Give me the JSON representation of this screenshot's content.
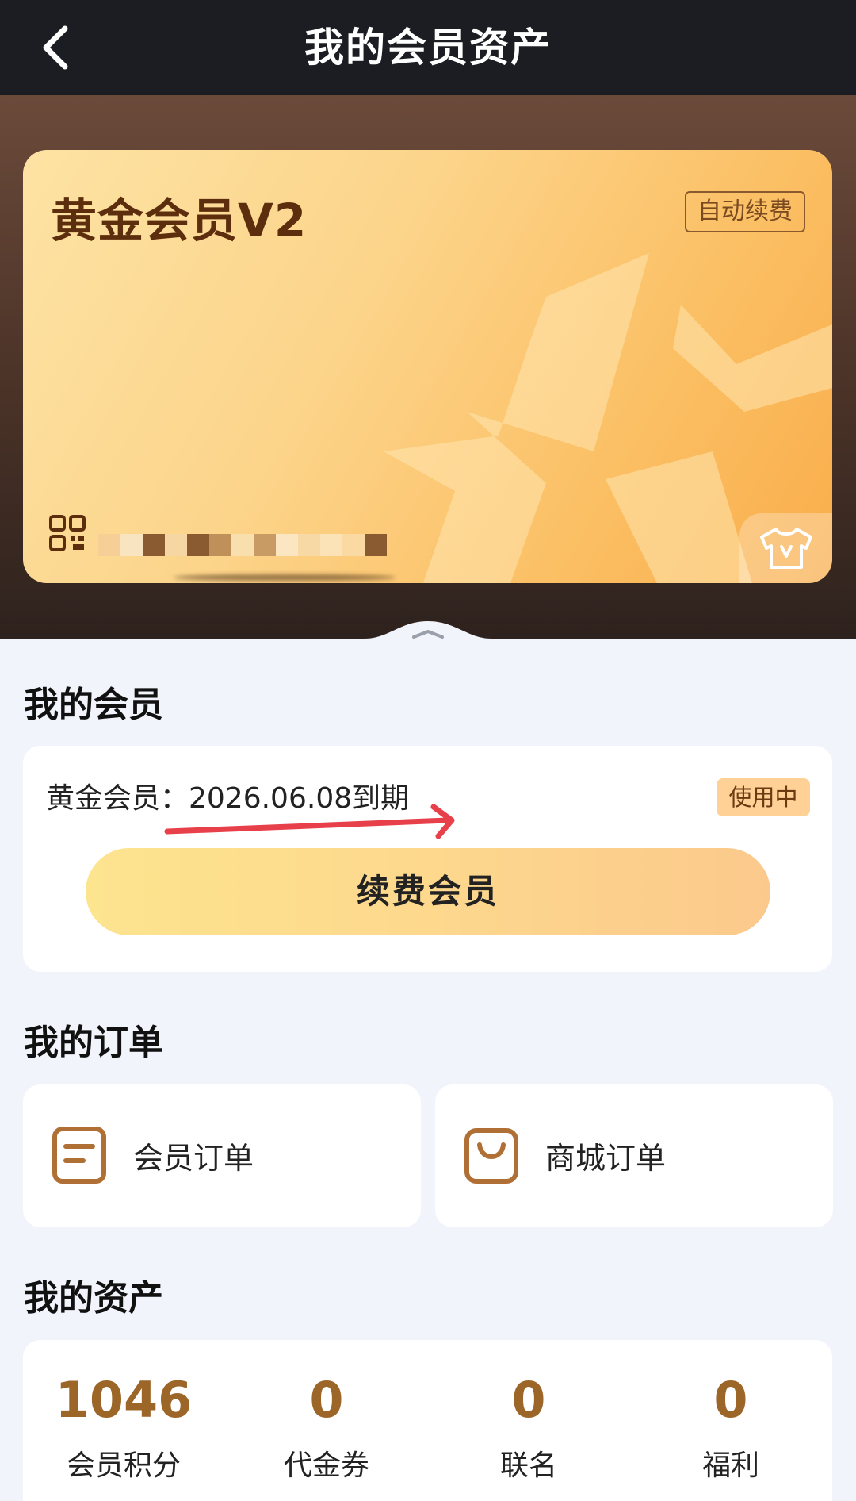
{
  "header": {
    "title": "我的会员资产"
  },
  "card": {
    "title": "黄金会员V2",
    "auto_renew_label": "自动续费"
  },
  "membership": {
    "section_title": "我的会员",
    "expiry_text": "黄金会员：2026.06.08到期",
    "status_badge": "使用中",
    "renew_button_label": "续费会员"
  },
  "orders": {
    "section_title": "我的订单",
    "items": [
      {
        "label": "会员订单",
        "icon": "document-icon"
      },
      {
        "label": "商城订单",
        "icon": "shopping-bag-icon"
      }
    ]
  },
  "assets": {
    "section_title": "我的资产",
    "items": [
      {
        "value": "1046",
        "label": "会员积分"
      },
      {
        "value": "0",
        "label": "代金券"
      },
      {
        "value": "0",
        "label": "联名"
      },
      {
        "value": "0",
        "label": "福利"
      }
    ]
  },
  "colors": {
    "topbar": "#1c1d22",
    "card_gold": "#fcd48a",
    "asset_value": "#9b6628",
    "badge_bg": "#ffd196",
    "annotation_arrow": "#e8404a"
  }
}
